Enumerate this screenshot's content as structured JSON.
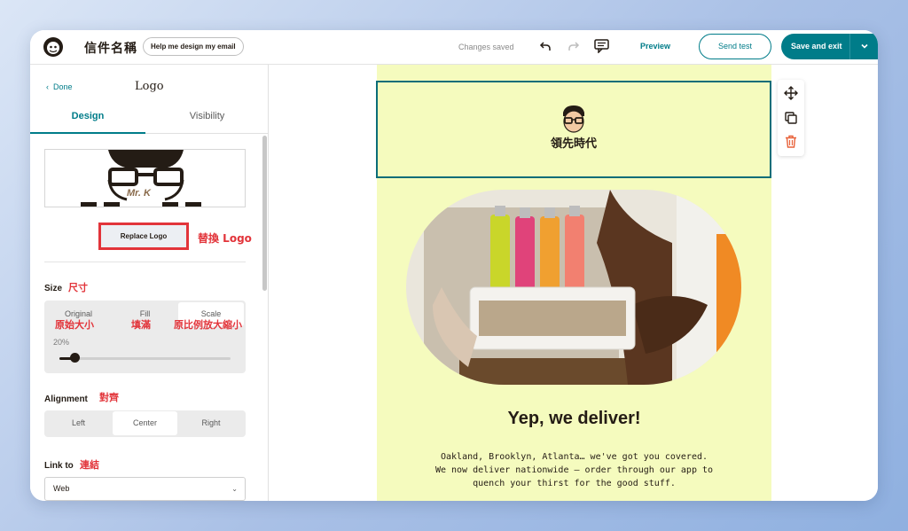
{
  "topbar": {
    "title": "信件名稱",
    "help_label": "Help me design my email",
    "changes_saved": "Changes saved",
    "preview_label": "Preview",
    "send_test_label": "Send test",
    "save_exit_label": "Save and exit"
  },
  "sidebar": {
    "back_label": "Done",
    "panel_title": "Logo",
    "tabs": [
      {
        "label": "Design"
      },
      {
        "label": "Visibility"
      }
    ],
    "logo_preview_text": "Mr. K",
    "replace_label": "Replace Logo",
    "replace_annotation": "替換 Logo",
    "size": {
      "label": "Size",
      "annotation": "尺寸",
      "options": [
        {
          "label": "Original",
          "annotation": "原始大小"
        },
        {
          "label": "Fill",
          "annotation": "填滿"
        },
        {
          "label": "Scale",
          "annotation": "原比例放大縮小"
        }
      ],
      "selected": "Scale",
      "scale_percent": "20%",
      "scale_value": 0.2
    },
    "alignment": {
      "label": "Alignment",
      "annotation": "對齊",
      "options": [
        {
          "label": "Left"
        },
        {
          "label": "Center"
        },
        {
          "label": "Right"
        }
      ],
      "selected": "Center"
    },
    "link": {
      "label": "Link to",
      "annotation": "連結",
      "value": "Web"
    }
  },
  "email": {
    "logo_text": "領先時代",
    "headline": "Yep, we deliver!",
    "body_lines": [
      "Oakland, Brooklyn, Atlanta… we've got you covered.",
      "We now deliver nationwide – order through our app to",
      "quench your thirst for the good stuff."
    ]
  },
  "colors": {
    "accent": "#007c89",
    "annotation_red": "#e2343a",
    "email_bg": "#f5fbbe",
    "trash": "#e8623a"
  }
}
